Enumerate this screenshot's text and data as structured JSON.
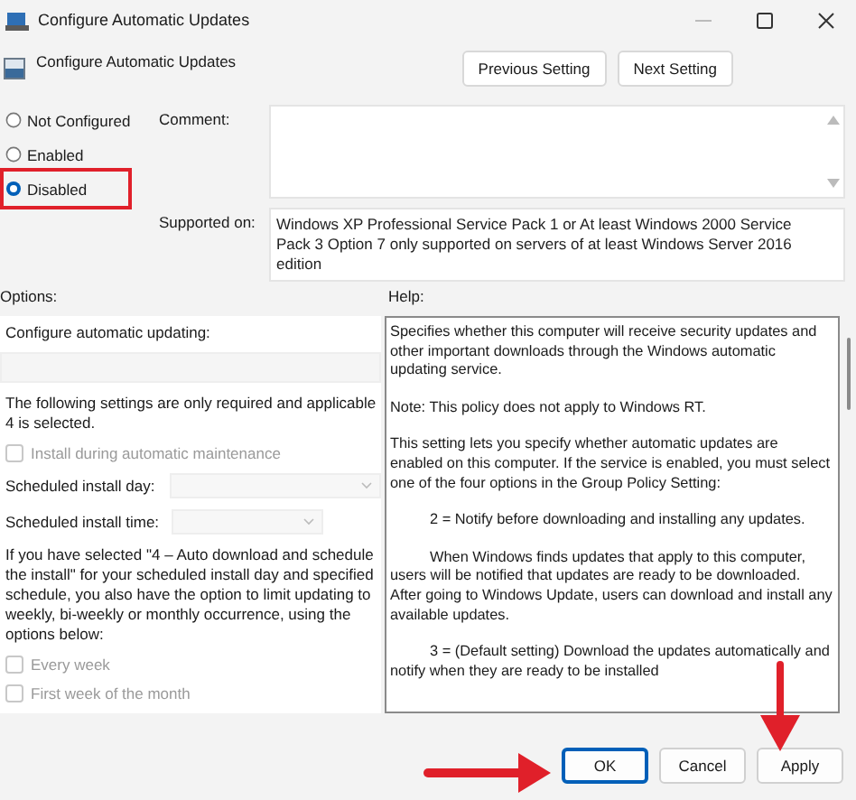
{
  "window": {
    "title": "Configure Automatic Updates"
  },
  "header": {
    "title": "Configure Automatic Updates",
    "buttons": [
      "Previous Setting",
      "Next Setting"
    ]
  },
  "state_options": [
    {
      "label": "Not Configured",
      "selected": false,
      "highlighted": false
    },
    {
      "label": "Enabled",
      "selected": false,
      "highlighted": false
    },
    {
      "label": "Disabled",
      "selected": true,
      "highlighted": true
    }
  ],
  "comment": {
    "label": "Comment:"
  },
  "supported_on": {
    "label": "Supported on:",
    "value": "Windows XP Professional Service Pack 1 or At least Windows 2000 Service Pack 3 Option 7 only supported on servers of at least Windows Server 2016 edition"
  },
  "options": {
    "label": "Options:",
    "items": [
      {
        "kind": "label",
        "text": "Configure automatic updating:"
      },
      {
        "kind": "dropdown",
        "disabled": true
      },
      {
        "kind": "paragraph",
        "lines": [
          "The following settings are only required and applicable",
          "4 is selected."
        ]
      },
      {
        "kind": "checkbox",
        "text": "Install during automatic maintenance",
        "checked": false,
        "disabled": true
      },
      {
        "kind": "labeled_dropdown",
        "text": "Scheduled install day:",
        "disabled": true,
        "wide": true
      },
      {
        "kind": "labeled_dropdown",
        "text": "Scheduled install time:",
        "disabled": true,
        "wide": false
      },
      {
        "kind": "paragraph",
        "lines": [
          "If you have selected \"4 – Auto download and schedule",
          "the install\" for your scheduled install day and specified",
          "schedule, you also have the option to limit updating to",
          "weekly, bi-weekly or monthly occurrence, using the",
          "options below:"
        ]
      },
      {
        "kind": "checkbox",
        "text": "Every week",
        "checked": false,
        "disabled": true
      },
      {
        "kind": "checkbox",
        "text": "First week of the month",
        "checked": false,
        "disabled": true
      }
    ]
  },
  "help": {
    "label": "Help:",
    "paragraphs": [
      {
        "text": "Specifies whether this computer will receive security updates and other important downloads through the Windows automatic updating service.",
        "indented": false
      },
      {
        "text": "Note: This policy does not apply to Windows RT.",
        "indented": false
      },
      {
        "text": "This setting lets you specify whether automatic updates are enabled on this computer. If the service is enabled, you must select one of the four options in the Group Policy Setting:",
        "indented": false
      },
      {
        "text": "2 = Notify before downloading and installing any updates.",
        "indented": true
      },
      {
        "text": "When Windows finds updates that apply to this computer, users will be notified that updates are ready to be downloaded. After going to Windows Update, users can download and install any available updates.",
        "indented": true
      },
      {
        "text": "3 = (Default setting) Download the updates automatically and notify when they are ready to be installed",
        "indented": true
      }
    ]
  },
  "buttons": [
    {
      "label": "OK",
      "default": true,
      "marker": {
        "kind": "arrow_from_left"
      }
    },
    {
      "label": "Cancel",
      "default": false
    },
    {
      "label": "Apply",
      "default": false,
      "marker": {
        "kind": "arrow_from_above"
      }
    }
  ]
}
